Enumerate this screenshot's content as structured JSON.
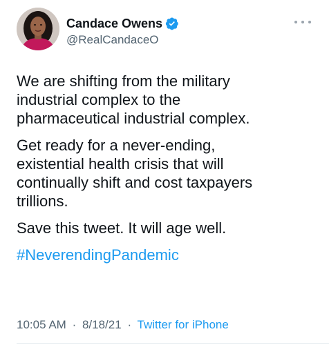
{
  "author": {
    "display_name": "Candace Owens",
    "handle": "@RealCandaceO",
    "verified": true,
    "avatar_icon": "profile-photo"
  },
  "tweet": {
    "paragraphs": [
      "We are shifting from the military\nindustrial complex to the\npharmaceutical industrial complex.",
      "Get ready for a never-ending,\nexistential health crisis that will\ncontinually shift and cost taxpayers\ntrillions.",
      "Save this tweet. It will age well."
    ],
    "hashtag": "#NeverendingPandemic"
  },
  "meta": {
    "time": "10:05 AM",
    "separator1": "·",
    "date": "8/18/21",
    "separator2": "·",
    "source": "Twitter for iPhone"
  },
  "colors": {
    "link": "#1d9bf0",
    "text": "#0f1419",
    "secondary": "#536471",
    "verified_badge": "#1d9bf0"
  }
}
